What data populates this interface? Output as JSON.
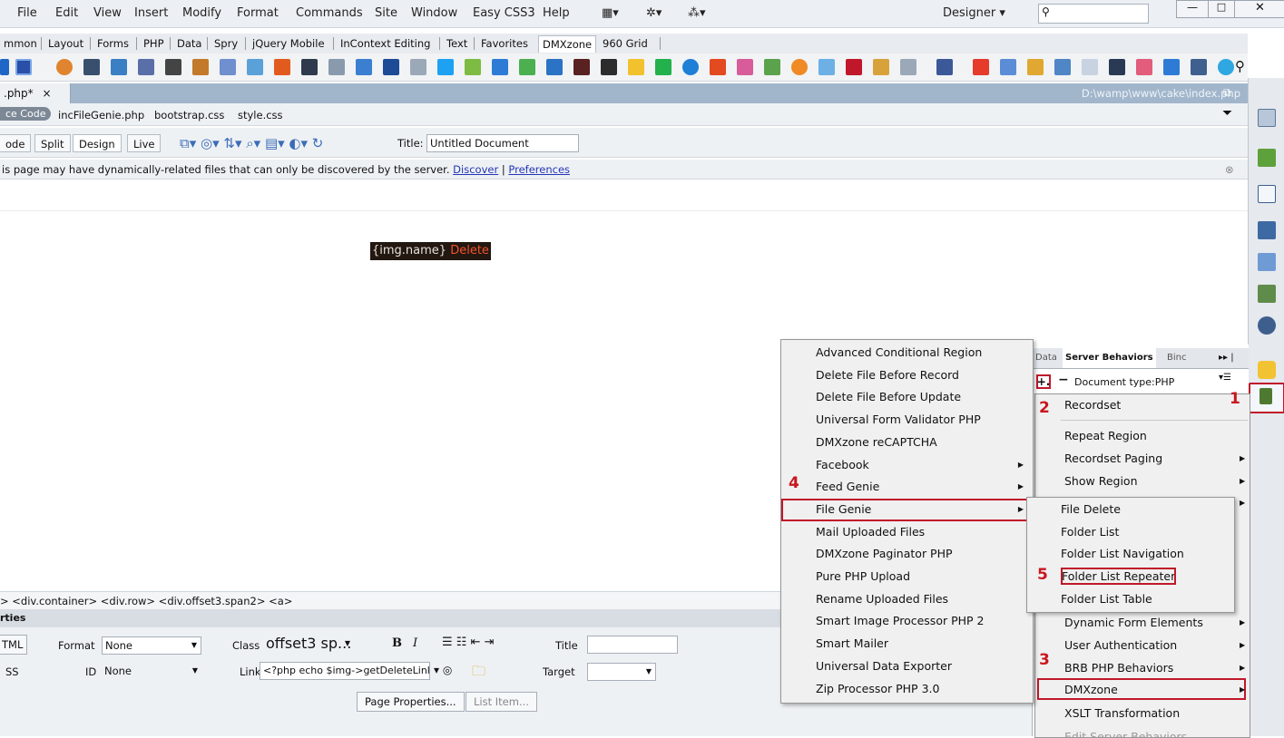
{
  "menubar": {
    "items": [
      "File",
      "Edit",
      "View",
      "Insert",
      "Modify",
      "Format",
      "Commands",
      "Site",
      "Window",
      "Easy CSS3",
      "Help"
    ],
    "workspace": "Designer",
    "search_placeholder": ""
  },
  "insert_tabs": [
    "mmon",
    "Layout",
    "Forms",
    "PHP",
    "Data",
    "Spry",
    "jQuery Mobile",
    "InContext Editing",
    "Text",
    "Favorites",
    "DMXzone",
    "960 Grid"
  ],
  "active_tab": "DMXzone",
  "document": {
    "tab_label": ".php*",
    "close": "×",
    "path": "D:\\wamp\\www\\cake\\index.php",
    "related_source": "ce Code",
    "related_files": [
      "incFileGenie.php",
      "bootstrap.css",
      "style.css"
    ]
  },
  "view_buttons": [
    "ode",
    "Split",
    "Design",
    "Live"
  ],
  "title_label": "Title:",
  "title_value": "Untitled Document",
  "infobar": {
    "text": "is page may have dynamically-related files that can only be discovered by the server.",
    "link1": "Discover",
    "pipe": "|",
    "link2": "Preferences"
  },
  "canvas": {
    "name_text": "{img.name}",
    "delete_text": "Delete"
  },
  "tag_selector": "> <div.container> <div.row> <div.offset3.span2> <a>",
  "properties": {
    "header": "rties",
    "html_btn": "TML",
    "css_btn": "SS",
    "format_label": "Format",
    "format_value": "None",
    "id_label": "ID",
    "id_value": "None",
    "class_label": "Class",
    "class_value": "offset3 sp...",
    "bold": "B",
    "italic": "I",
    "link_label": "Link",
    "link_value": "<?php echo $img->getDeleteLink(",
    "title_label": "Title",
    "target_label": "Target",
    "page_props_btn": "Page Properties...",
    "list_item_btn": "List Item..."
  },
  "panel": {
    "tabs": [
      "Data",
      "Server Behaviors",
      "Binc"
    ],
    "add": "+.",
    "minus": "−",
    "doctype": "Document type:PHP",
    "items": [
      "Recordset",
      "Repeat Region",
      "Recordset Paging",
      "Show Region",
      "",
      "",
      "",
      "",
      "Dynamic Form Elements",
      "User Authentication",
      "BRB PHP Behaviors",
      "DMXzone",
      "XSLT Transformation",
      "Edit Server Behaviors..."
    ]
  },
  "dmx_menu": [
    "Advanced Conditional Region",
    "Delete File Before Record",
    "Delete File Before Update",
    "Universal Form Validator PHP",
    "DMXzone reCAPTCHA",
    "Facebook",
    "Feed Genie",
    "File Genie",
    "Mail Uploaded Files",
    "DMXzone Paginator PHP",
    "Pure PHP Upload",
    "Rename Uploaded Files",
    "Smart Image Processor PHP 2",
    "Smart Mailer",
    "Universal Data Exporter",
    "Zip Processor PHP 3.0"
  ],
  "filegenie_menu": [
    "File Delete",
    "Folder List",
    "Folder List Navigation",
    "Folder List Repeater",
    "Folder List Table"
  ],
  "callouts": [
    "1",
    "2",
    "3",
    "4",
    "5"
  ],
  "colors": {
    "highlight": "#c0182a",
    "doc_bar": "#a2b6cb"
  }
}
